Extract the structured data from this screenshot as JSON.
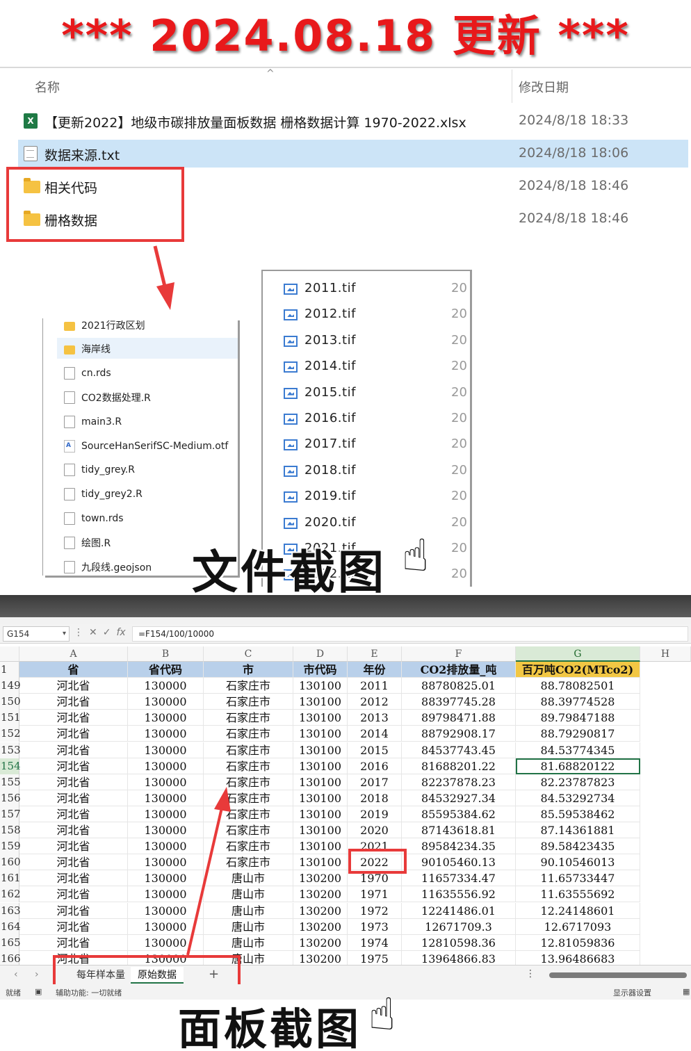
{
  "banner": {
    "title": "*** 2024.08.18 更新 ***"
  },
  "explorer": {
    "col_name": "名称",
    "col_date": "修改日期",
    "files": [
      {
        "name": "【更新2022】地级市碳排放量面板数据 栅格数据计算 1970-2022.xlsx",
        "date": "2024/8/18 18:33",
        "type": "xlsx",
        "icon": "excel-file-icon"
      },
      {
        "name": "数据来源.txt",
        "date": "2024/8/18 18:06",
        "type": "txt",
        "icon": "text-file-icon"
      },
      {
        "name": "相关代码",
        "date": "2024/8/18 18:46",
        "type": "folder",
        "icon": "folder-icon"
      },
      {
        "name": "栅格数据",
        "date": "2024/8/18 18:46",
        "type": "folder",
        "icon": "folder-icon"
      }
    ]
  },
  "code_folder": {
    "items": [
      {
        "name": "2021行政区划",
        "type": "folder"
      },
      {
        "name": "海岸线",
        "type": "folder"
      },
      {
        "name": "cn.rds",
        "type": "file"
      },
      {
        "name": "CO2数据处理.R",
        "type": "file"
      },
      {
        "name": "main3.R",
        "type": "file"
      },
      {
        "name": "SourceHanSerifSC-Medium.otf",
        "type": "font"
      },
      {
        "name": "tidy_grey.R",
        "type": "file"
      },
      {
        "name": "tidy_grey2.R",
        "type": "file"
      },
      {
        "name": "town.rds",
        "type": "file"
      },
      {
        "name": "绘图.R",
        "type": "file"
      },
      {
        "name": "九段线.geojson",
        "type": "file"
      }
    ]
  },
  "raster_folder": {
    "items": [
      {
        "name": "2011.tif",
        "date": "20"
      },
      {
        "name": "2012.tif",
        "date": "20"
      },
      {
        "name": "2013.tif",
        "date": "20"
      },
      {
        "name": "2014.tif",
        "date": "20"
      },
      {
        "name": "2015.tif",
        "date": "20"
      },
      {
        "name": "2016.tif",
        "date": "20"
      },
      {
        "name": "2017.tif",
        "date": "20"
      },
      {
        "name": "2018.tif",
        "date": "20"
      },
      {
        "name": "2019.tif",
        "date": "20"
      },
      {
        "name": "2020.tif",
        "date": "20"
      },
      {
        "name": "2021.tif",
        "date": "20"
      },
      {
        "name": "2022.tif",
        "date": "20"
      }
    ]
  },
  "captions": {
    "files": "文件截图",
    "panel": "面板截图"
  },
  "excel": {
    "namebox": "G154",
    "formula": "=F154/100/10000",
    "col_letters": [
      "A",
      "B",
      "C",
      "D",
      "E",
      "F",
      "G",
      "H"
    ],
    "header_row_num": "1",
    "headers": [
      "省",
      "省代码",
      "市",
      "市代码",
      "年份",
      "CO2排放量_吨",
      "百万吨CO2(MTco2)"
    ],
    "rows": [
      {
        "num": "149",
        "cells": [
          "河北省",
          "130000",
          "石家庄市",
          "130100",
          "2011",
          "88780825.01",
          "88.78082501"
        ]
      },
      {
        "num": "150",
        "cells": [
          "河北省",
          "130000",
          "石家庄市",
          "130100",
          "2012",
          "88397745.28",
          "88.39774528"
        ]
      },
      {
        "num": "151",
        "cells": [
          "河北省",
          "130000",
          "石家庄市",
          "130100",
          "2013",
          "89798471.88",
          "89.79847188"
        ]
      },
      {
        "num": "152",
        "cells": [
          "河北省",
          "130000",
          "石家庄市",
          "130100",
          "2014",
          "88792908.17",
          "88.79290817"
        ]
      },
      {
        "num": "153",
        "cells": [
          "河北省",
          "130000",
          "石家庄市",
          "130100",
          "2015",
          "84537743.45",
          "84.53774345"
        ]
      },
      {
        "num": "154",
        "cells": [
          "河北省",
          "130000",
          "石家庄市",
          "130100",
          "2016",
          "81688201.22",
          "81.68820122"
        ]
      },
      {
        "num": "155",
        "cells": [
          "河北省",
          "130000",
          "石家庄市",
          "130100",
          "2017",
          "82237878.23",
          "82.23787823"
        ]
      },
      {
        "num": "156",
        "cells": [
          "河北省",
          "130000",
          "石家庄市",
          "130100",
          "2018",
          "84532927.34",
          "84.53292734"
        ]
      },
      {
        "num": "157",
        "cells": [
          "河北省",
          "130000",
          "石家庄市",
          "130100",
          "2019",
          "85595384.62",
          "85.59538462"
        ]
      },
      {
        "num": "158",
        "cells": [
          "河北省",
          "130000",
          "石家庄市",
          "130100",
          "2020",
          "87143618.81",
          "87.14361881"
        ]
      },
      {
        "num": "159",
        "cells": [
          "河北省",
          "130000",
          "石家庄市",
          "130100",
          "2021",
          "89584234.35",
          "89.58423435"
        ]
      },
      {
        "num": "160",
        "cells": [
          "河北省",
          "130000",
          "石家庄市",
          "130100",
          "2022",
          "90105460.13",
          "90.10546013"
        ]
      },
      {
        "num": "161",
        "cells": [
          "河北省",
          "130000",
          "唐山市",
          "130200",
          "1970",
          "11657334.47",
          "11.65733447"
        ]
      },
      {
        "num": "162",
        "cells": [
          "河北省",
          "130000",
          "唐山市",
          "130200",
          "1971",
          "11635556.92",
          "11.63555692"
        ]
      },
      {
        "num": "163",
        "cells": [
          "河北省",
          "130000",
          "唐山市",
          "130200",
          "1972",
          "12241486.01",
          "12.24148601"
        ]
      },
      {
        "num": "164",
        "cells": [
          "河北省",
          "130000",
          "唐山市",
          "130200",
          "1973",
          "12671709.3",
          "12.6717093"
        ]
      },
      {
        "num": "165",
        "cells": [
          "河北省",
          "130000",
          "唐山市",
          "130200",
          "1974",
          "12810598.36",
          "12.81059836"
        ]
      },
      {
        "num": "166",
        "cells": [
          "河北省",
          "130000",
          "唐山市",
          "130200",
          "1975",
          "13964866.83",
          "13.96486683"
        ]
      }
    ],
    "sheets": [
      "每年样本量",
      "原始数据"
    ],
    "active_sheet": "原始数据",
    "status_ready": "就绪",
    "status_accessibility": "辅助功能: 一切就绪",
    "status_display": "显示器设置"
  },
  "colors": {
    "accent_red": "#e83a3a",
    "banner_red": "#e8191b",
    "excel_green": "#217346",
    "header_blue": "#b9d0ea",
    "header_gold": "#f2c744"
  }
}
